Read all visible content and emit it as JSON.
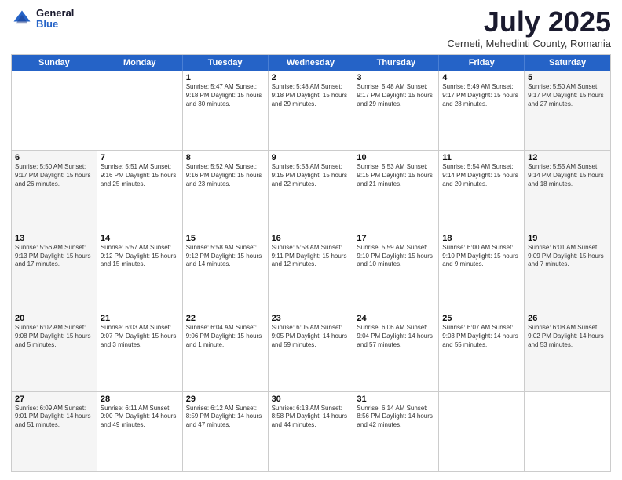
{
  "header": {
    "logo_general": "General",
    "logo_blue": "Blue",
    "month_title": "July 2025",
    "subtitle": "Cerneti, Mehedinti County, Romania"
  },
  "days_of_week": [
    "Sunday",
    "Monday",
    "Tuesday",
    "Wednesday",
    "Thursday",
    "Friday",
    "Saturday"
  ],
  "weeks": [
    [
      {
        "day": "",
        "info": ""
      },
      {
        "day": "",
        "info": ""
      },
      {
        "day": "1",
        "info": "Sunrise: 5:47 AM\nSunset: 9:18 PM\nDaylight: 15 hours\nand 30 minutes."
      },
      {
        "day": "2",
        "info": "Sunrise: 5:48 AM\nSunset: 9:18 PM\nDaylight: 15 hours\nand 29 minutes."
      },
      {
        "day": "3",
        "info": "Sunrise: 5:48 AM\nSunset: 9:17 PM\nDaylight: 15 hours\nand 29 minutes."
      },
      {
        "day": "4",
        "info": "Sunrise: 5:49 AM\nSunset: 9:17 PM\nDaylight: 15 hours\nand 28 minutes."
      },
      {
        "day": "5",
        "info": "Sunrise: 5:50 AM\nSunset: 9:17 PM\nDaylight: 15 hours\nand 27 minutes."
      }
    ],
    [
      {
        "day": "6",
        "info": "Sunrise: 5:50 AM\nSunset: 9:17 PM\nDaylight: 15 hours\nand 26 minutes."
      },
      {
        "day": "7",
        "info": "Sunrise: 5:51 AM\nSunset: 9:16 PM\nDaylight: 15 hours\nand 25 minutes."
      },
      {
        "day": "8",
        "info": "Sunrise: 5:52 AM\nSunset: 9:16 PM\nDaylight: 15 hours\nand 23 minutes."
      },
      {
        "day": "9",
        "info": "Sunrise: 5:53 AM\nSunset: 9:15 PM\nDaylight: 15 hours\nand 22 minutes."
      },
      {
        "day": "10",
        "info": "Sunrise: 5:53 AM\nSunset: 9:15 PM\nDaylight: 15 hours\nand 21 minutes."
      },
      {
        "day": "11",
        "info": "Sunrise: 5:54 AM\nSunset: 9:14 PM\nDaylight: 15 hours\nand 20 minutes."
      },
      {
        "day": "12",
        "info": "Sunrise: 5:55 AM\nSunset: 9:14 PM\nDaylight: 15 hours\nand 18 minutes."
      }
    ],
    [
      {
        "day": "13",
        "info": "Sunrise: 5:56 AM\nSunset: 9:13 PM\nDaylight: 15 hours\nand 17 minutes."
      },
      {
        "day": "14",
        "info": "Sunrise: 5:57 AM\nSunset: 9:12 PM\nDaylight: 15 hours\nand 15 minutes."
      },
      {
        "day": "15",
        "info": "Sunrise: 5:58 AM\nSunset: 9:12 PM\nDaylight: 15 hours\nand 14 minutes."
      },
      {
        "day": "16",
        "info": "Sunrise: 5:58 AM\nSunset: 9:11 PM\nDaylight: 15 hours\nand 12 minutes."
      },
      {
        "day": "17",
        "info": "Sunrise: 5:59 AM\nSunset: 9:10 PM\nDaylight: 15 hours\nand 10 minutes."
      },
      {
        "day": "18",
        "info": "Sunrise: 6:00 AM\nSunset: 9:10 PM\nDaylight: 15 hours\nand 9 minutes."
      },
      {
        "day": "19",
        "info": "Sunrise: 6:01 AM\nSunset: 9:09 PM\nDaylight: 15 hours\nand 7 minutes."
      }
    ],
    [
      {
        "day": "20",
        "info": "Sunrise: 6:02 AM\nSunset: 9:08 PM\nDaylight: 15 hours\nand 5 minutes."
      },
      {
        "day": "21",
        "info": "Sunrise: 6:03 AM\nSunset: 9:07 PM\nDaylight: 15 hours\nand 3 minutes."
      },
      {
        "day": "22",
        "info": "Sunrise: 6:04 AM\nSunset: 9:06 PM\nDaylight: 15 hours\nand 1 minute."
      },
      {
        "day": "23",
        "info": "Sunrise: 6:05 AM\nSunset: 9:05 PM\nDaylight: 14 hours\nand 59 minutes."
      },
      {
        "day": "24",
        "info": "Sunrise: 6:06 AM\nSunset: 9:04 PM\nDaylight: 14 hours\nand 57 minutes."
      },
      {
        "day": "25",
        "info": "Sunrise: 6:07 AM\nSunset: 9:03 PM\nDaylight: 14 hours\nand 55 minutes."
      },
      {
        "day": "26",
        "info": "Sunrise: 6:08 AM\nSunset: 9:02 PM\nDaylight: 14 hours\nand 53 minutes."
      }
    ],
    [
      {
        "day": "27",
        "info": "Sunrise: 6:09 AM\nSunset: 9:01 PM\nDaylight: 14 hours\nand 51 minutes."
      },
      {
        "day": "28",
        "info": "Sunrise: 6:11 AM\nSunset: 9:00 PM\nDaylight: 14 hours\nand 49 minutes."
      },
      {
        "day": "29",
        "info": "Sunrise: 6:12 AM\nSunset: 8:59 PM\nDaylight: 14 hours\nand 47 minutes."
      },
      {
        "day": "30",
        "info": "Sunrise: 6:13 AM\nSunset: 8:58 PM\nDaylight: 14 hours\nand 44 minutes."
      },
      {
        "day": "31",
        "info": "Sunrise: 6:14 AM\nSunset: 8:56 PM\nDaylight: 14 hours\nand 42 minutes."
      },
      {
        "day": "",
        "info": ""
      },
      {
        "day": "",
        "info": ""
      }
    ]
  ]
}
